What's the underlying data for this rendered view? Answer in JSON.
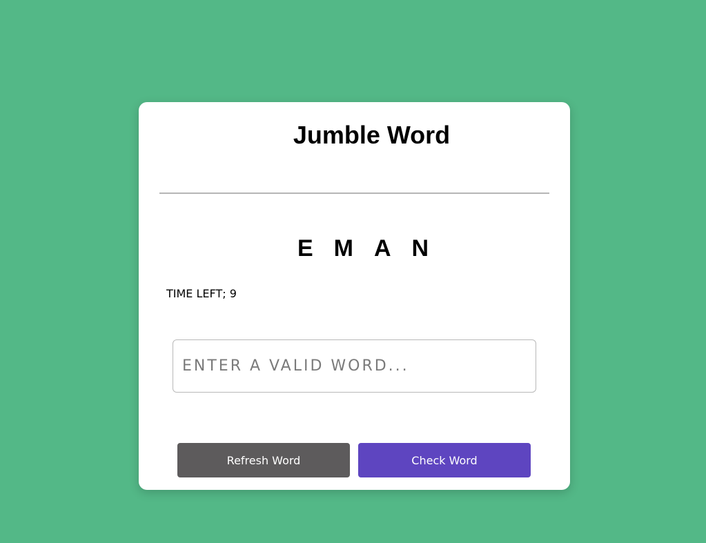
{
  "game": {
    "title": "Jumble Word",
    "scrambled_word": "EMAN",
    "timer": {
      "text": "TIME LEFT; 9"
    },
    "input": {
      "value": "",
      "placeholder": "ENTER A VALID WORD..."
    },
    "buttons": {
      "refresh_label": "Refresh Word",
      "check_label": "Check Word"
    },
    "colors": {
      "background": "#53b887",
      "card": "#ffffff",
      "refresh_button": "#5d5b5c",
      "check_button": "#5e45c0"
    }
  }
}
